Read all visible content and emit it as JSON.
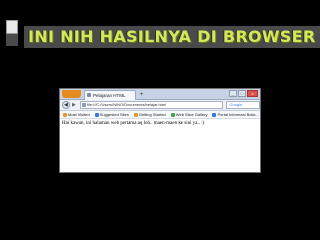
{
  "slide": {
    "title": "INI NIH HASILNYA DI BROWSER"
  },
  "browser": {
    "tab_title": "Pelajaran HTML",
    "new_tab": "+",
    "url": "file:///C:/Users/NINO/Documents/belajar.html",
    "search_engine": "Google",
    "window_controls": {
      "minimize": "_",
      "maximize": "□",
      "close": "x"
    },
    "bookmarks": [
      {
        "label": "Most Visited"
      },
      {
        "label": "Suggested Sites"
      },
      {
        "label": "Getting Started"
      },
      {
        "label": "Web Slice Gallery"
      },
      {
        "label": "Portal Informasi Bokk..."
      }
    ],
    "content_text": "Hai kawan, ini halaman web pertama aq loh.. maen-maen ke sini ya.. :)"
  },
  "colors": {
    "title_color": "#d3e85c",
    "title_bar": "#4a4a4a",
    "firefox_orange": "#e58a1f"
  },
  "icons": {
    "app_menu": "firefox-menu-icon",
    "back": "back-arrow-icon",
    "forward": "forward-arrow-icon",
    "page": "page-icon"
  }
}
